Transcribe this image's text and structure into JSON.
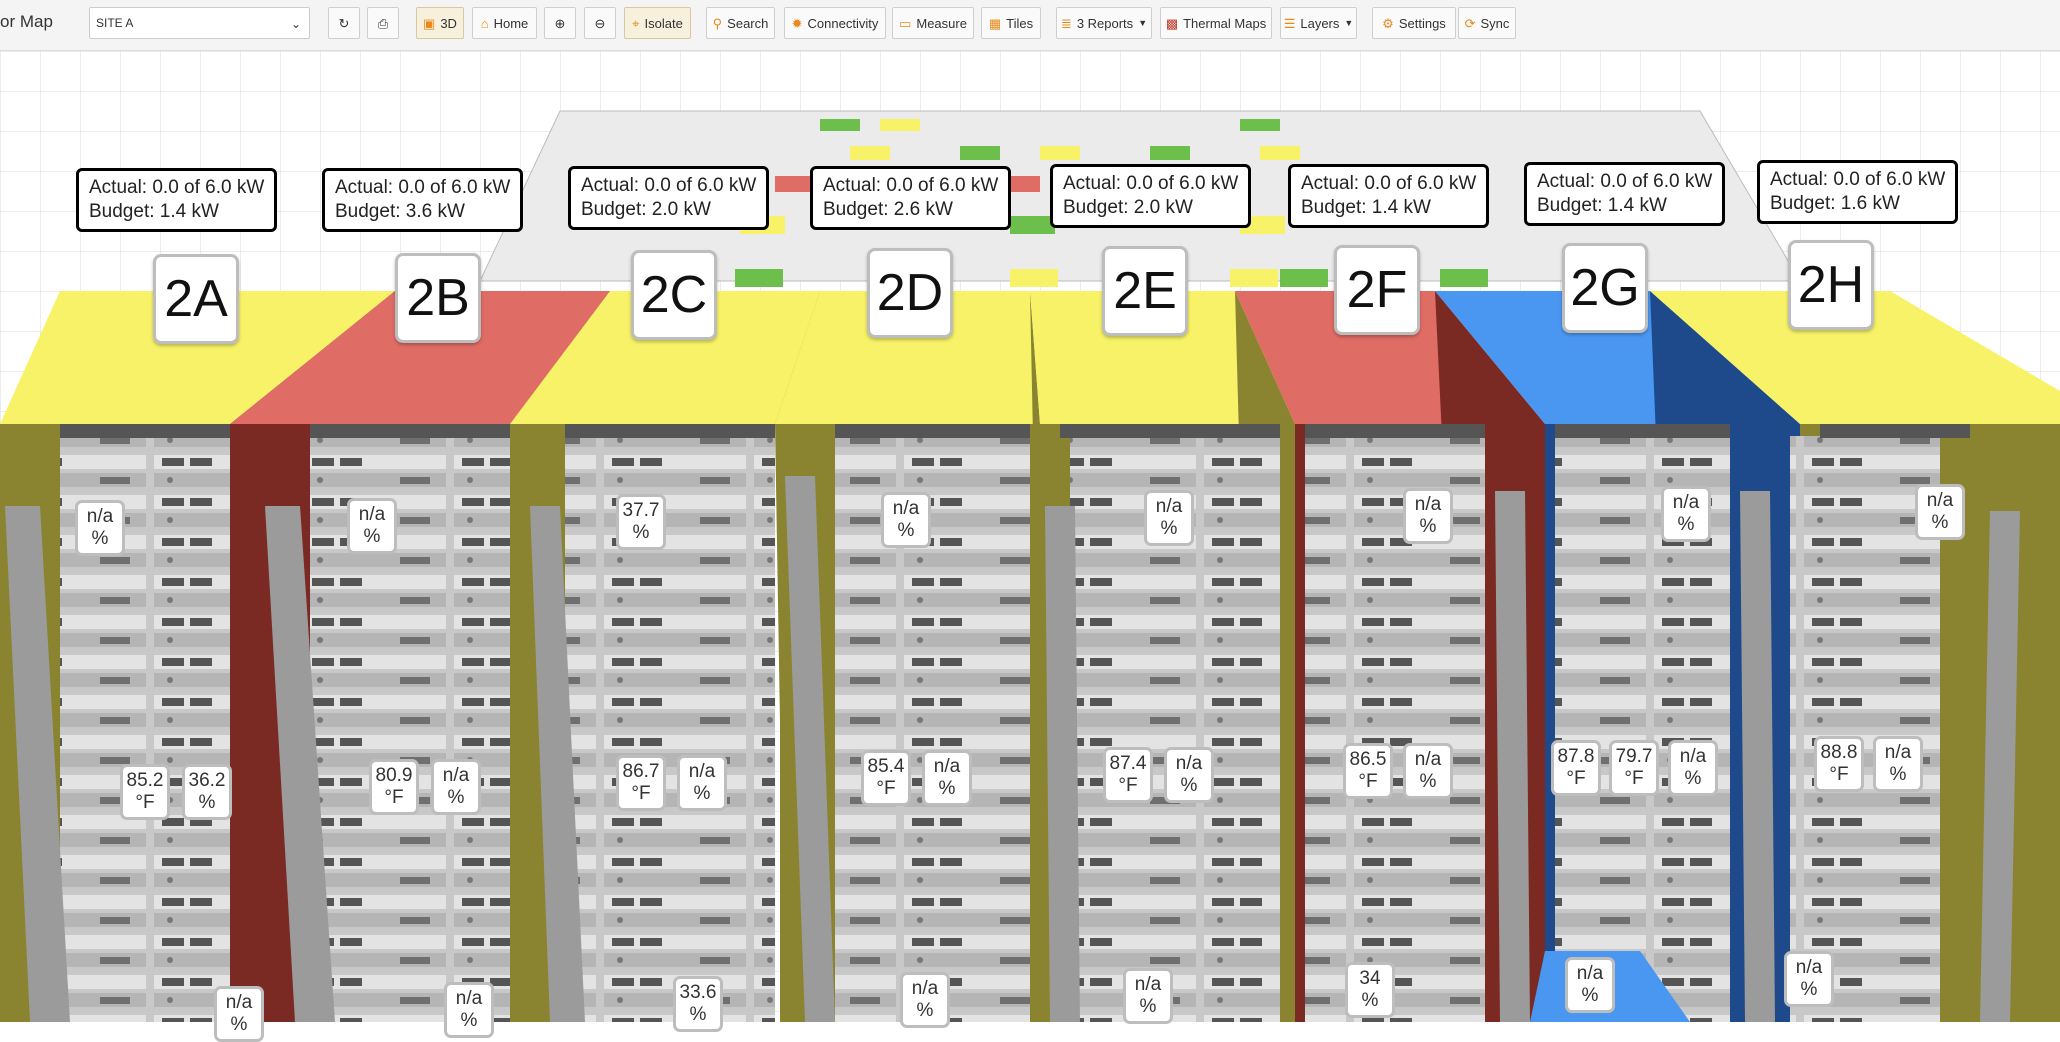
{
  "app": {
    "title": "or Map"
  },
  "site_select": {
    "value": "SITE A"
  },
  "toolbar": {
    "view_3d": "3D",
    "home": "Home",
    "isolate": "Isolate",
    "search": "Search",
    "connectivity": "Connectivity",
    "measure": "Measure",
    "tiles": "Tiles",
    "reports": "3 Reports",
    "thermal_maps": "Thermal Maps",
    "layers": "Layers",
    "settings": "Settings",
    "sync": "Sync"
  },
  "colors": {
    "yellow": "#f7f268",
    "red": "#e06c66",
    "blue": "#4a97f2",
    "olive": "#8a8430"
  },
  "racks": [
    {
      "name": "2A",
      "actual": "Actual: 0.0 of 6.0 kW",
      "budget": "Budget: 1.4 kW",
      "color": "yellow",
      "top_badge": [
        "n/a",
        "%"
      ],
      "mid_badges": [
        [
          "85.2",
          "°F"
        ],
        [
          "36.2",
          "%"
        ]
      ],
      "bottom_badge": [
        "n/a",
        "%"
      ]
    },
    {
      "name": "2B",
      "actual": "Actual: 0.0 of 6.0 kW",
      "budget": "Budget: 3.6 kW",
      "color": "red",
      "top_badge": [
        "n/a",
        "%"
      ],
      "mid_badges": [
        [
          "80.9",
          "°F"
        ],
        [
          "n/a",
          "%"
        ]
      ],
      "bottom_badge": [
        "n/a",
        "%"
      ]
    },
    {
      "name": "2C",
      "actual": "Actual: 0.0 of 6.0 kW",
      "budget": "Budget: 2.0 kW",
      "color": "yellow",
      "top_badge": [
        "37.7",
        "%"
      ],
      "mid_badges": [
        [
          "86.7",
          "°F"
        ],
        [
          "n/a",
          "%"
        ]
      ],
      "bottom_badge": [
        "33.6",
        "%"
      ]
    },
    {
      "name": "2D",
      "actual": "Actual: 0.0 of 6.0 kW",
      "budget": "Budget: 2.6 kW",
      "color": "yellow",
      "top_badge": [
        "n/a",
        "%"
      ],
      "mid_badges": [
        [
          "85.4",
          "°F"
        ],
        [
          "n/a",
          "%"
        ]
      ],
      "bottom_badge": [
        "n/a",
        "%"
      ]
    },
    {
      "name": "2E",
      "actual": "Actual: 0.0 of 6.0 kW",
      "budget": "Budget: 2.0 kW",
      "color": "yellow",
      "top_badge": [
        "n/a",
        "%"
      ],
      "mid_badges": [
        [
          "87.4",
          "°F"
        ],
        [
          "n/a",
          "%"
        ]
      ],
      "bottom_badge": [
        "n/a",
        "%"
      ]
    },
    {
      "name": "2F",
      "actual": "Actual: 0.0 of 6.0 kW",
      "budget": "Budget: 1.4 kW",
      "color": "red",
      "top_badge": [
        "n/a",
        "%"
      ],
      "mid_badges": [
        [
          "86.5",
          "°F"
        ],
        [
          "n/a",
          "%"
        ]
      ],
      "bottom_badge": [
        "34",
        "%"
      ]
    },
    {
      "name": "2G",
      "actual": "Actual: 0.0 of 6.0 kW",
      "budget": "Budget: 1.4 kW",
      "color": "blue",
      "top_badge": [
        "n/a",
        "%"
      ],
      "mid_badges": [
        [
          "87.8",
          "°F"
        ],
        [
          "79.7",
          "°F"
        ],
        [
          "n/a",
          "%"
        ]
      ],
      "bottom_badge": [
        "n/a",
        "%"
      ]
    },
    {
      "name": "2H",
      "actual": "Actual: 0.0 of 6.0 kW",
      "budget": "Budget: 1.6 kW",
      "color": "yellow",
      "top_badge": [
        "n/a",
        "%"
      ],
      "mid_badges": [
        [
          "88.8",
          "°F"
        ],
        [
          "n/a",
          "%"
        ]
      ],
      "bottom_badge": [
        "n/a",
        "%"
      ]
    }
  ]
}
